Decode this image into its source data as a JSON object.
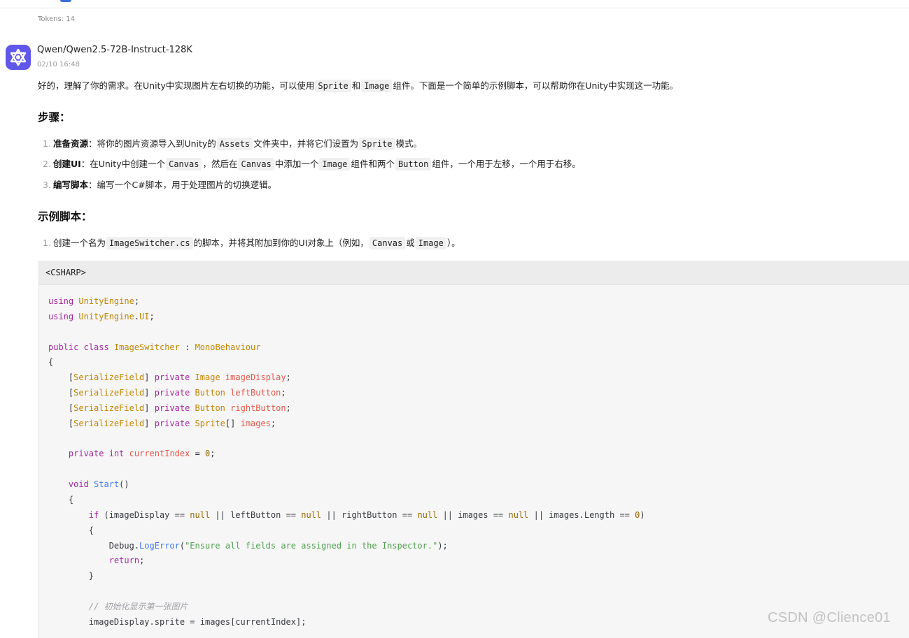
{
  "tokens": "Tokens: 14",
  "message": {
    "avatar_icon": "qwen-logo-icon",
    "avatar_color": "#6157ea",
    "model": "Qwen/Qwen2.5-72B-Instruct-128K",
    "time": "02/10 16:48",
    "intro": {
      "t1": "好的，理解了你的需求。在Unity中实现图片左右切换的功能，可以使用",
      "c1": "Sprite",
      "t2": "和",
      "c2": "Image",
      "t3": "组件。下面是一个简单的示例脚本，可以帮助你在Unity中实现这一功能。"
    },
    "steps_heading": "步骤：",
    "steps": [
      {
        "num": "1.",
        "title": "准备资源",
        "t1": "：将你的图片资源导入到Unity的",
        "c1": "Assets",
        "t2": "文件夹中，并将它们设置为",
        "c2": "Sprite",
        "t3": "模式。"
      },
      {
        "num": "2.",
        "title": "创建UI",
        "t1": "：在Unity中创建一个",
        "c1": "Canvas",
        "t2": "，然后在",
        "c2": "Canvas",
        "t3": "中添加一个",
        "c3": "Image",
        "t4": "组件和两个",
        "c4": "Button",
        "t5": "组件，一个用于左移，一个用于右移。"
      },
      {
        "num": "3.",
        "title": "编写脚本",
        "t1": "：编写一个C#脚本，用于处理图片的切换逻辑。"
      }
    ],
    "example_heading": "示例脚本：",
    "example_step": {
      "num": "1.",
      "t1": "创建一个名为",
      "c1": "ImageSwitcher.cs",
      "t2": "的脚本，并将其附加到你的UI对象上（例如，",
      "c2": "Canvas",
      "t3": "或",
      "c3": "Image",
      "t4": "）。"
    },
    "code": {
      "language_label": "<CSHARP>",
      "lines": [
        "using UnityEngine;",
        "using UnityEngine.UI;",
        "",
        "public class ImageSwitcher : MonoBehaviour",
        "{",
        "    [SerializeField] private Image imageDisplay;",
        "    [SerializeField] private Button leftButton;",
        "    [SerializeField] private Button rightButton;",
        "    [SerializeField] private Sprite[] images;",
        "",
        "    private int currentIndex = 0;",
        "",
        "    void Start()",
        "    {",
        "        if (imageDisplay == null || leftButton == null || rightButton == null || images == null || images.Length == 0)",
        "        {",
        "            Debug.LogError(\"Ensure all fields are assigned in the Inspector.\");",
        "            return;",
        "        }",
        "",
        "        // 初始化显示第一张图片",
        "        imageDisplay.sprite = images[currentIndex];"
      ]
    }
  },
  "watermark": "CSDN @Clience01"
}
